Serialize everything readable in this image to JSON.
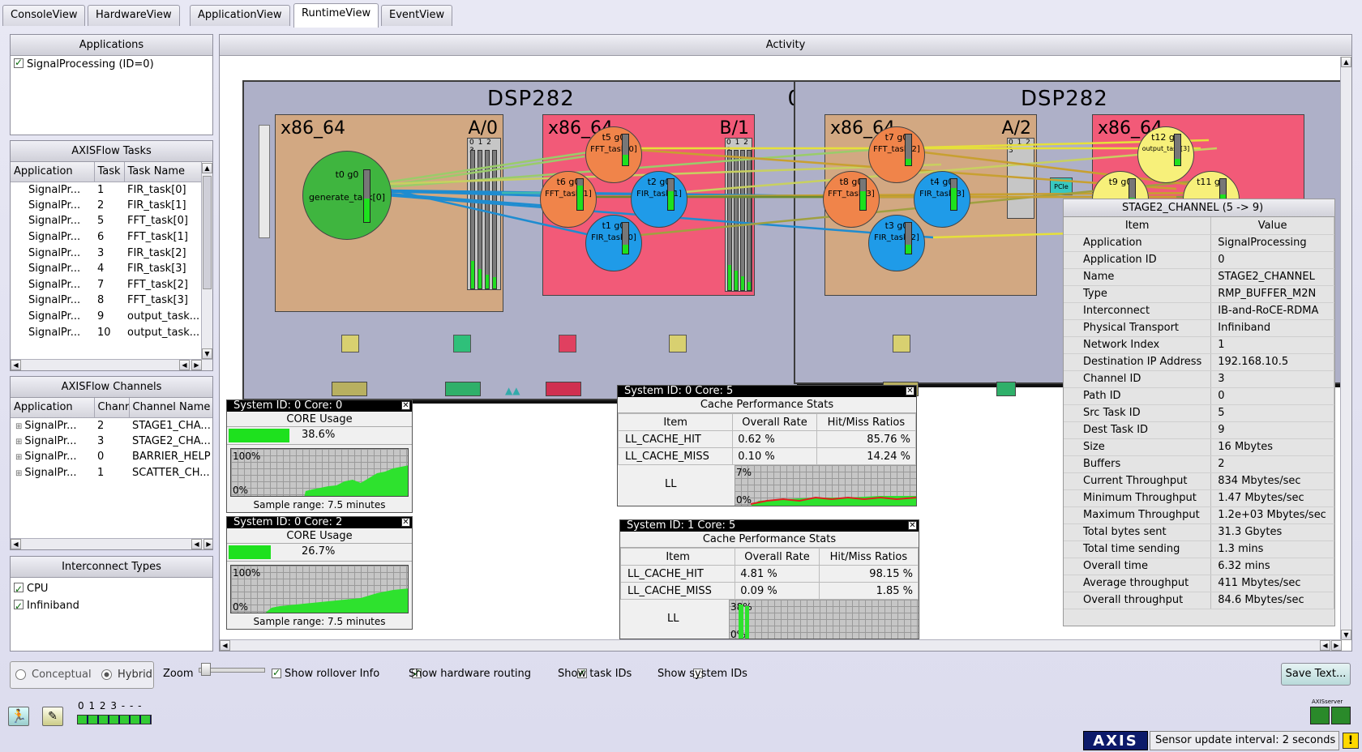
{
  "tabs": [
    {
      "label": "ConsoleView",
      "active": false
    },
    {
      "label": "HardwareView",
      "active": false
    },
    {
      "label": "ApplicationView",
      "active": false
    },
    {
      "label": "RuntimeView",
      "active": true
    },
    {
      "label": "EventView",
      "active": false
    }
  ],
  "applications": {
    "header": "Applications",
    "items": [
      {
        "label": "SignalProcessing (ID=0)",
        "checked": true
      }
    ]
  },
  "tasks": {
    "header": "AXISFlow Tasks",
    "columns": [
      "Application",
      "Task",
      "Task Name"
    ],
    "rows": [
      [
        "SignalPr...",
        "1",
        "FIR_task[0]"
      ],
      [
        "SignalPr...",
        "2",
        "FIR_task[1]"
      ],
      [
        "SignalPr...",
        "5",
        "FFT_task[0]"
      ],
      [
        "SignalPr...",
        "6",
        "FFT_task[1]"
      ],
      [
        "SignalPr...",
        "3",
        "FIR_task[2]"
      ],
      [
        "SignalPr...",
        "4",
        "FIR_task[3]"
      ],
      [
        "SignalPr...",
        "7",
        "FFT_task[2]"
      ],
      [
        "SignalPr...",
        "8",
        "FFT_task[3]"
      ],
      [
        "SignalPr...",
        "9",
        "output_task..."
      ],
      [
        "SignalPr...",
        "10",
        "output_task..."
      ]
    ]
  },
  "channels": {
    "header": "AXISFlow Channels",
    "columns": [
      "Application",
      "Chanr",
      "Channel Name"
    ],
    "rows": [
      [
        "SignalPr...",
        "2",
        "STAGE1_CHA..."
      ],
      [
        "SignalPr...",
        "3",
        "STAGE2_CHA..."
      ],
      [
        "SignalPr...",
        "0",
        "BARRIER_HELP"
      ],
      [
        "SignalPr...",
        "1",
        "SCATTER_CH..."
      ]
    ]
  },
  "interconnect": {
    "header": "Interconnect Types",
    "items": [
      {
        "label": "CPU",
        "checked": true
      },
      {
        "label": "Infiniband",
        "checked": true
      }
    ]
  },
  "activity": {
    "header": "Activity",
    "dsp1": {
      "title": "DSP282",
      "index": "0"
    },
    "dsp2": {
      "title": "DSP282"
    },
    "cpus": [
      {
        "arch": "x86_64",
        "tag": "A/0",
        "cores": "0 1 2 3"
      },
      {
        "arch": "x86_64",
        "tag": "B/1",
        "cores": "0 1 2 3"
      },
      {
        "arch": "x86_64",
        "tag": "A/2",
        "cores": "0 1 2 3"
      },
      {
        "arch": "x86_64",
        "tag": ""
      }
    ],
    "nodes": [
      {
        "id": "t0 g0",
        "name": "generate_task[0]",
        "color": "#3fb53f",
        "level": 0.45
      },
      {
        "id": "t5 g0",
        "name": "FFT_task[0]",
        "color": "#f0844a",
        "level": 0.35
      },
      {
        "id": "t6 g0",
        "name": "FFT_task[1]",
        "color": "#f0844a",
        "level": 0.8
      },
      {
        "id": "t2 g0",
        "name": "FIR_task[1]",
        "color": "#1f9be8",
        "level": 0.6
      },
      {
        "id": "t1 g0",
        "name": "FIR_task[0]",
        "color": "#1f9be8",
        "level": 0.3
      },
      {
        "id": "t7 g0",
        "name": "FFT_task[2]",
        "color": "#f0844a",
        "level": 0.2
      },
      {
        "id": "t8 g0",
        "name": "FFT_task[3]",
        "color": "#f0844a",
        "level": 0.6
      },
      {
        "id": "t4 g0",
        "name": "FIR_task[3]",
        "color": "#1f9be8",
        "level": 0.7
      },
      {
        "id": "t3 g0",
        "name": "FIR_task[2]",
        "color": "#1f9be8",
        "level": 0.3
      },
      {
        "id": "t12 g0",
        "name": "output_task[3]",
        "color": "#f7f07a",
        "level": 0.2
      },
      {
        "id": "t9 g0",
        "name": "",
        "color": "#f7f07a",
        "level": 0.4
      },
      {
        "id": "t11 g0",
        "name": "",
        "color": "#f7f07a",
        "level": 0.5
      }
    ],
    "pcie_label": "PCIe"
  },
  "core0": {
    "title": "System ID: 0 Core: 0",
    "label": "CORE Usage",
    "value": "38.6%",
    "fraction": 0.386,
    "ymax": "100%",
    "ymin": "0%",
    "footer": "Sample range: 7.5 minutes"
  },
  "core2": {
    "title": "System ID: 0 Core: 2",
    "label": "CORE Usage",
    "value": "26.7%",
    "fraction": 0.267,
    "ymax": "100%",
    "ymin": "0%",
    "footer": "Sample range: 7.5 minutes"
  },
  "cache5a": {
    "title": "System ID: 0 Core: 5",
    "header": "Cache Performance Stats",
    "columns": [
      "Item",
      "Overall Rate",
      "Hit/Miss Ratios"
    ],
    "rows": [
      [
        "LL_CACHE_HIT",
        "0.62 %",
        "85.76 %"
      ],
      [
        "LL_CACHE_MISS",
        "0.10 %",
        "14.24 %"
      ]
    ],
    "graph_label": "LL",
    "ymax": "7%",
    "ymin": "0%"
  },
  "cache5b": {
    "title": "System ID: 1 Core: 5",
    "header": "Cache Performance Stats",
    "columns": [
      "Item",
      "Overall Rate",
      "Hit/Miss Ratios"
    ],
    "rows": [
      [
        "LL_CACHE_HIT",
        "4.81 %",
        "98.15 %"
      ],
      [
        "LL_CACHE_MISS",
        "0.09 %",
        "1.85 %"
      ]
    ],
    "graph_label": "LL",
    "ymax": "38%",
    "ymin": "0%"
  },
  "channel_info": {
    "title": "STAGE2_CHANNEL (5 -> 9)",
    "columns": [
      "Item",
      "Value"
    ],
    "rows": [
      [
        "Application",
        "SignalProcessing"
      ],
      [
        "Application ID",
        "0"
      ],
      [
        "Name",
        "STAGE2_CHANNEL"
      ],
      [
        "Type",
        "RMP_BUFFER_M2N"
      ],
      [
        "Interconnect",
        "IB-and-RoCE-RDMA"
      ],
      [
        "Physical Transport",
        "Infiniband"
      ],
      [
        "Network Index",
        "1"
      ],
      [
        "Destination IP Address",
        "192.168.10.5"
      ],
      [
        "Channel ID",
        "3"
      ],
      [
        "Path ID",
        "0"
      ],
      [
        "Src Task ID",
        "5"
      ],
      [
        "Dest Task ID",
        "9"
      ],
      [
        "Size",
        "16 Mbytes"
      ],
      [
        "Buffers",
        "2"
      ],
      [
        "Current Throughput",
        "834 Mbytes/sec"
      ],
      [
        "Minimum Throughput",
        "1.47 Mbytes/sec"
      ],
      [
        "Maximum Throughput",
        "1.2e+03 Mbytes/sec"
      ],
      [
        "Total bytes sent",
        "31.3 Gbytes"
      ],
      [
        "Total time sending",
        "1.3 mins"
      ],
      [
        "Overall time",
        "6.32 mins"
      ],
      [
        "Average throughput",
        "411 Mbytes/sec"
      ],
      [
        "Overall throughput",
        "84.6 Mbytes/sec"
      ]
    ]
  },
  "controls": {
    "conceptual": "Conceptual",
    "hybrid": "Hybrid",
    "zoom": "Zoom",
    "rollover": "Show rollover Info",
    "hw_routing": "Show hardware routing",
    "task_ids": "Show task IDs",
    "system_ids": "Show system IDs",
    "save": "Save Text..."
  },
  "status": {
    "cores_label": "0 1 2 3 - - -",
    "sensor": "Sensor update interval: 2 seconds",
    "logo": "AXIS",
    "server_label": "AXISserver"
  }
}
